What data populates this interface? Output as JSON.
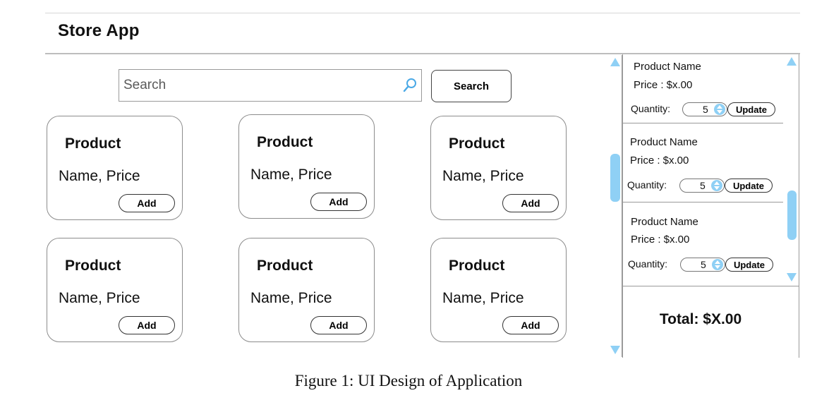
{
  "header": {
    "title": "Store App"
  },
  "search": {
    "placeholder": "Search",
    "value": "",
    "button_label": "Search",
    "icon": "search-icon"
  },
  "products": [
    {
      "title": "Product",
      "subtitle": "Name, Price",
      "add_label": "Add"
    },
    {
      "title": "Product",
      "subtitle": "Name, Price",
      "add_label": "Add"
    },
    {
      "title": "Product",
      "subtitle": "Name, Price",
      "add_label": "Add"
    },
    {
      "title": "Product",
      "subtitle": "Name, Price",
      "add_label": "Add"
    },
    {
      "title": "Product",
      "subtitle": "Name, Price",
      "add_label": "Add"
    },
    {
      "title": "Product",
      "subtitle": "Name, Price",
      "add_label": "Add"
    }
  ],
  "cart": {
    "items": [
      {
        "name": "Product Name",
        "price": "Price : $x.00",
        "quantity_label": "Quantity:",
        "quantity": "5",
        "update_label": "Update"
      },
      {
        "name": "Product Name",
        "price": "Price : $x.00",
        "quantity_label": "Quantity:",
        "quantity": "5",
        "update_label": "Update"
      },
      {
        "name": "Product Name",
        "price": "Price : $x.00",
        "quantity_label": "Quantity:",
        "quantity": "5",
        "update_label": "Update"
      }
    ],
    "total": "Total: $X.00"
  },
  "caption": "Figure 1: UI Design of Application",
  "colors": {
    "scroll_accent": "#8fd0f5",
    "border": "#8c8c8c"
  }
}
